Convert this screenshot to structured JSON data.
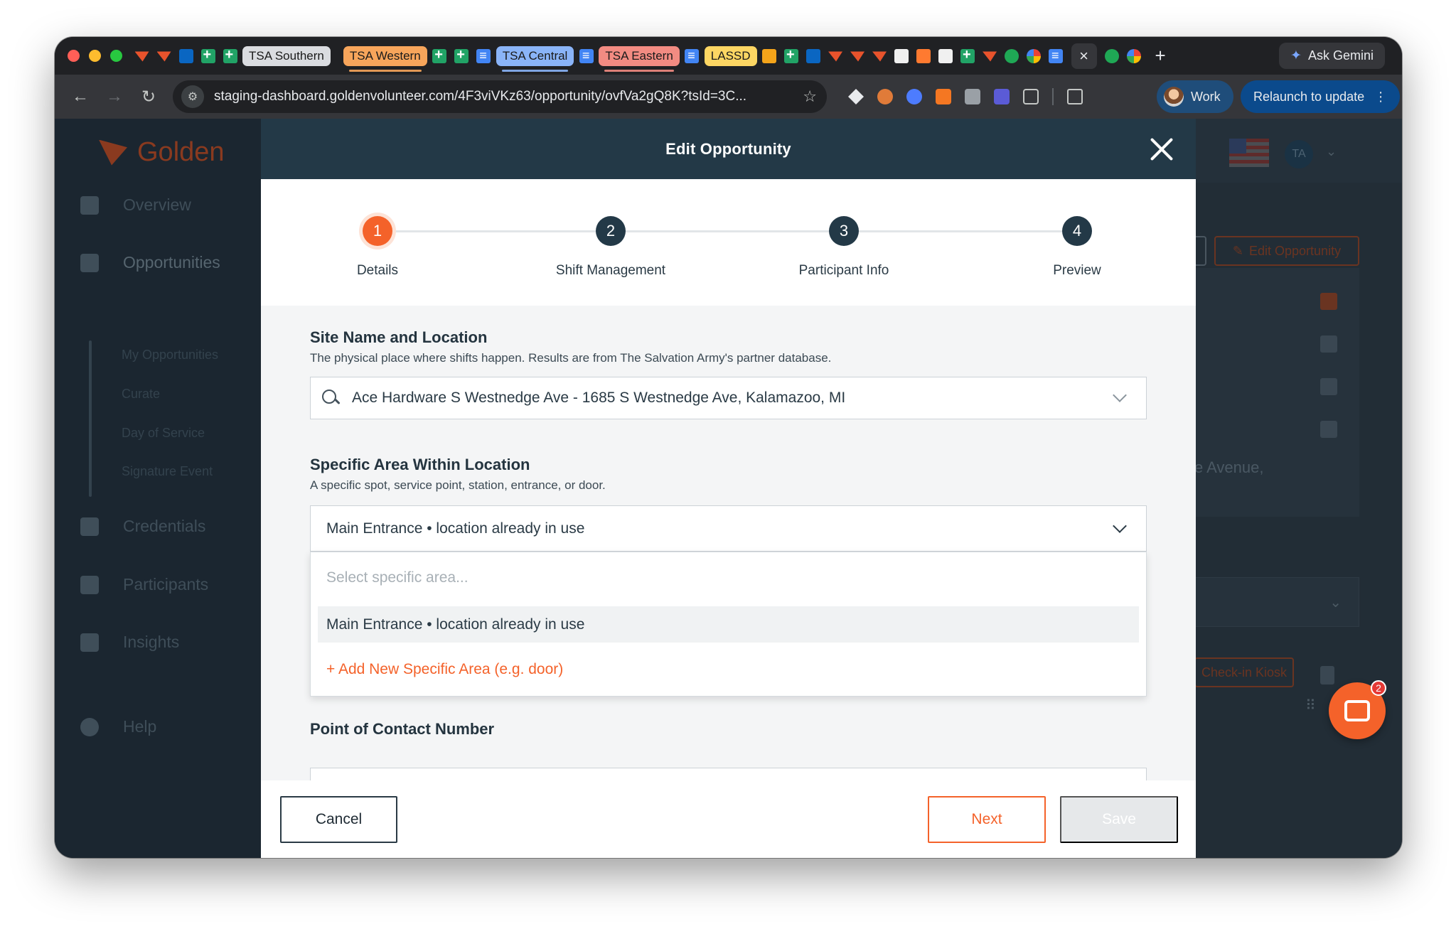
{
  "browser": {
    "tabs": [
      "TSA Southern",
      "TSA Western",
      "TSA Central",
      "TSA Eastern",
      "LASSD"
    ],
    "active_tab_close": "×",
    "new_tab": "+",
    "gemini_label": "Ask Gemini",
    "url": "staging-dashboard.goldenvolunteer.com/4F3viVKz63/opportunity/ovfVa2gQ8K?tsId=3C...",
    "profile_label": "Work",
    "relaunch_label": "Relaunch to update"
  },
  "app": {
    "logo_text": "Golden",
    "nav": {
      "overview": "Overview",
      "opportunities": "Opportunities",
      "my_opportunities": "My Opportunities",
      "curate": "Curate",
      "day_of_service": "Day of Service",
      "signature_event": "Signature Event",
      "credentials": "Credentials",
      "participants": "Participants",
      "insights": "Insights",
      "help": "Help"
    },
    "avatar_initials": "TA",
    "edit_opportunity_button": "Edit Opportunity",
    "address_fragment": "e Avenue,",
    "check_in_kiosk": "Check-in Kiosk",
    "chat_badge_count": "2"
  },
  "modal": {
    "title": "Edit Opportunity",
    "steps": [
      {
        "num": "1",
        "label": "Details"
      },
      {
        "num": "2",
        "label": "Shift Management"
      },
      {
        "num": "3",
        "label": "Participant Info"
      },
      {
        "num": "4",
        "label": "Preview"
      }
    ],
    "site": {
      "title": "Site Name and Location",
      "help": "The physical place where shifts happen. Results are from The Salvation Army's partner database.",
      "value": "Ace Hardware S Westnedge Ave - 1685 S Westnedge Ave, Kalamazoo, MI"
    },
    "area": {
      "title": "Specific Area Within Location",
      "help": "A specific spot, service point, station, entrance, or door.",
      "value": "Main Entrance • location already in use",
      "placeholder": "Select specific area...",
      "option": "Main Entrance • location already in use",
      "add_new": "+ Add New Specific Area (e.g. door)"
    },
    "poc_title": "Point of Contact Number",
    "buttons": {
      "cancel": "Cancel",
      "next": "Next",
      "save": "Save"
    }
  },
  "colors": {
    "accent": "#f4622a",
    "header": "#233947"
  }
}
